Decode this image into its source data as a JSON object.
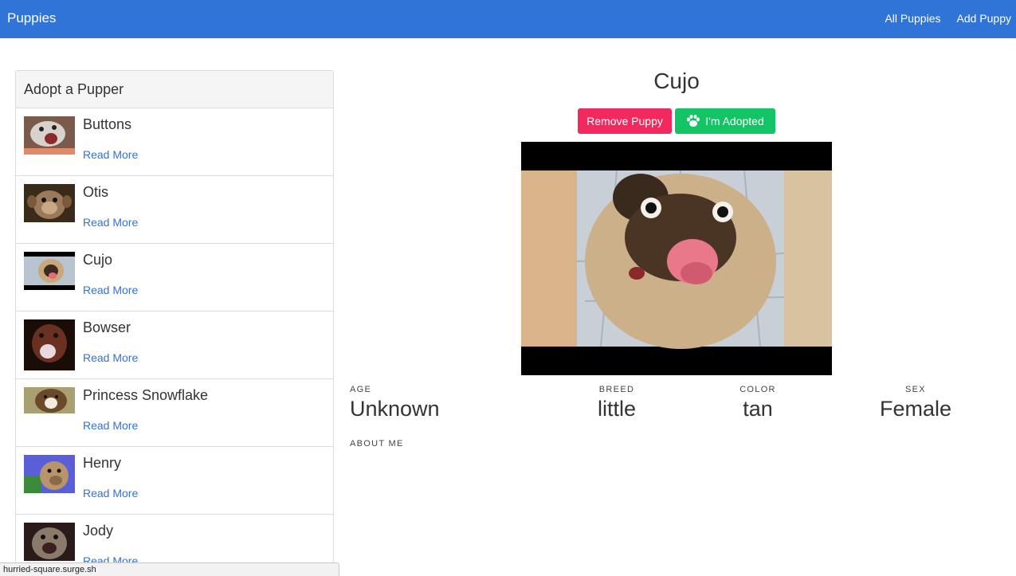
{
  "navbar": {
    "brand": "Puppies",
    "links": [
      "All Puppies",
      "Add Puppy"
    ]
  },
  "sidebar": {
    "title": "Adopt a Pupper",
    "items": [
      {
        "name": "Buttons",
        "link": "Read More"
      },
      {
        "name": "Otis",
        "link": "Read More"
      },
      {
        "name": "Cujo",
        "link": "Read More"
      },
      {
        "name": "Bowser",
        "link": "Read More"
      },
      {
        "name": "Princess Snowflake",
        "link": "Read More"
      },
      {
        "name": "Henry",
        "link": "Read More"
      },
      {
        "name": "Jody",
        "link": "Read More"
      }
    ]
  },
  "detail": {
    "name": "Cujo",
    "remove_label": "Remove Puppy",
    "adopted_label": "I'm Adopted",
    "adopted_icon": "paw-icon",
    "stats": {
      "age_label": "AGE",
      "age": "Unknown",
      "breed_label": "BREED",
      "breed": "little",
      "color_label": "COLOR",
      "color": "tan",
      "sex_label": "SEX",
      "sex": "Female"
    },
    "about_label": "ABOUT ME"
  },
  "colors": {
    "navbar": "#2f74d6",
    "link": "#2f74d6",
    "danger": "#f2295f",
    "success": "#12c466"
  },
  "status_bar": "hurried-square.surge.sh"
}
